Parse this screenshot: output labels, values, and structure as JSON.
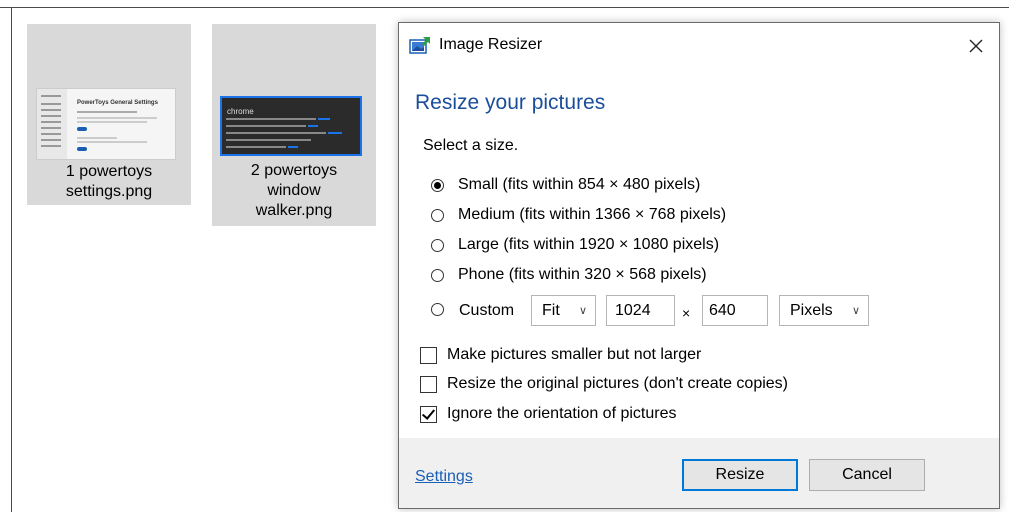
{
  "files": [
    {
      "name_line1": "1 powertoys",
      "name_line2": "settings.png",
      "thumb_title": "PowerToys General Settings"
    },
    {
      "name_line1": "2 powertoys",
      "name_line2": "window",
      "name_line3": "walker.png",
      "thumb_title": "chrome"
    }
  ],
  "dialog": {
    "title": "Image Resizer",
    "heading": "Resize your pictures",
    "prompt": "Select a size.",
    "sizes": [
      {
        "label": "Small (fits within 854 × 480 pixels)",
        "checked": true
      },
      {
        "label": "Medium (fits within 1366 × 768 pixels)",
        "checked": false
      },
      {
        "label": "Large (fits within 1920 × 1080 pixels)",
        "checked": false
      },
      {
        "label": "Phone (fits within 320 × 568 pixels)",
        "checked": false
      }
    ],
    "custom": {
      "label": "Custom",
      "fit": "Fit",
      "width": "1024",
      "times": "×",
      "height": "640",
      "unit": "Pixels"
    },
    "options": [
      {
        "label": "Make pictures smaller but not larger",
        "checked": false
      },
      {
        "label": "Resize the original pictures (don't create copies)",
        "checked": false
      },
      {
        "label": "Ignore the orientation of pictures",
        "checked": true
      }
    ],
    "settings_link": "Settings",
    "resize_button": "Resize",
    "cancel_button": "Cancel"
  },
  "colors": {
    "heading": "#1a4e9a",
    "link": "#1a5fb4",
    "accent": "#0078d7"
  }
}
